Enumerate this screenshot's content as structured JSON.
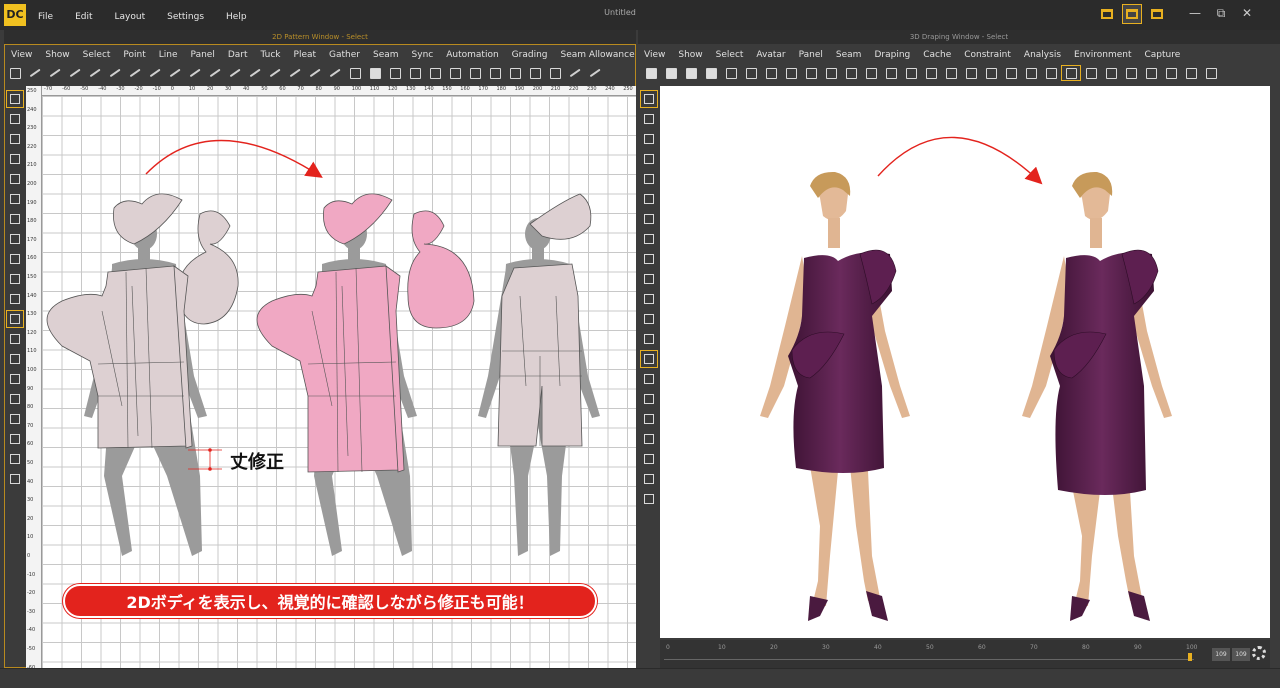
{
  "app": {
    "logo": "DC",
    "doc_title": "Untitled",
    "menu": [
      "File",
      "Edit",
      "Layout",
      "Settings",
      "Help"
    ]
  },
  "window_controls": [
    "—",
    "⧉",
    "✕"
  ],
  "pattern_window": {
    "title": "2D Pattern Window - Select",
    "menu": [
      "View",
      "Show",
      "Select",
      "Point",
      "Line",
      "Panel",
      "Dart",
      "Tuck",
      "Pleat",
      "Gather",
      "Seam",
      "Sync",
      "Automation",
      "Grading",
      "Seam Allowance"
    ],
    "ruler_top": [
      "-70",
      "-60",
      "-50",
      "-40",
      "-30",
      "-20",
      "-10",
      "0",
      "10",
      "20",
      "30",
      "40",
      "50",
      "60",
      "70",
      "80",
      "90",
      "100",
      "110",
      "120",
      "130",
      "140",
      "150",
      "160",
      "170",
      "180",
      "190",
      "200",
      "210",
      "220",
      "230",
      "240",
      "250"
    ],
    "ruler_left": [
      "250",
      "240",
      "230",
      "220",
      "210",
      "200",
      "190",
      "180",
      "170",
      "160",
      "150",
      "140",
      "130",
      "120",
      "110",
      "100",
      "90",
      "80",
      "70",
      "60",
      "50",
      "40",
      "30",
      "20",
      "10",
      "0",
      "-10",
      "-20",
      "-30",
      "-40",
      "-50",
      "-60"
    ],
    "annotation": "丈修正",
    "banner": "2Dボディを表示し、視覚的に確認しながら修正も可能！"
  },
  "draping_window": {
    "title": "3D Draping Window - Select",
    "menu": [
      "View",
      "Show",
      "Select",
      "Avatar",
      "Panel",
      "Seam",
      "Draping",
      "Cache",
      "Constraint",
      "Analysis",
      "Environment",
      "Capture"
    ],
    "timeline_ticks": [
      "0",
      "10",
      "20",
      "30",
      "40",
      "50",
      "60",
      "70",
      "80",
      "90",
      "100"
    ],
    "frame_current": "109",
    "frame_total": "109"
  },
  "colors": {
    "accent": "#e8b020",
    "dress": "#5a1f4c",
    "highlight_pattern": "#f0a8c3",
    "base_pattern": "#ddd0d2",
    "body_silhouette": "#9b9b9b",
    "arrow": "#e3231d"
  },
  "icons": [
    "select-icon",
    "move-icon",
    "rotate-icon",
    "camera-icon",
    "gear-icon"
  ]
}
